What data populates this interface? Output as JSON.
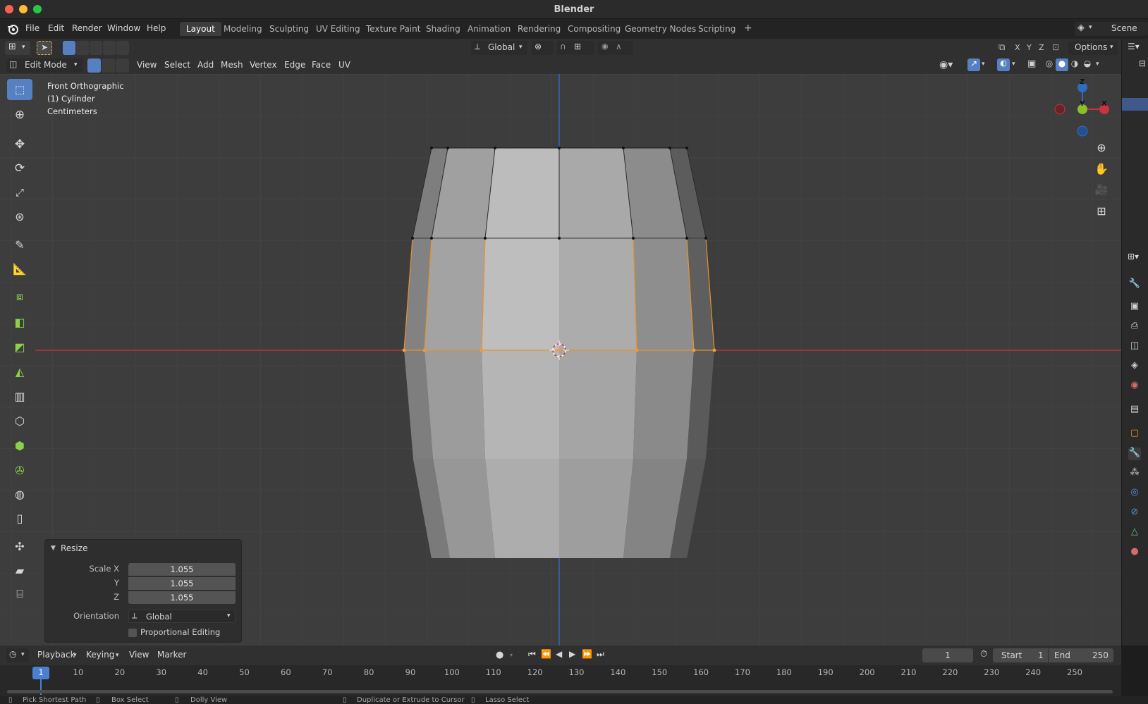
{
  "window": {
    "title": "Blender"
  },
  "menubar": {
    "items": [
      "File",
      "Edit",
      "Render",
      "Window",
      "Help"
    ],
    "tabs": [
      "Layout",
      "Modeling",
      "Sculpting",
      "UV Editing",
      "Texture Paint",
      "Shading",
      "Animation",
      "Rendering",
      "Compositing",
      "Geometry Nodes",
      "Scripting"
    ],
    "active_tab": "Layout",
    "add_tab": "+",
    "scene": "Scene"
  },
  "header1": {
    "orientation": "Global",
    "axes": [
      "X",
      "Y",
      "Z"
    ],
    "options": "Options"
  },
  "header2": {
    "mode": "Edit Mode",
    "menus": [
      "View",
      "Select",
      "Add",
      "Mesh",
      "Vertex",
      "Edge",
      "Face",
      "UV"
    ]
  },
  "viewport": {
    "view_name": "Front Orthographic",
    "object_name": "(1) Cylinder",
    "units": "Centimeters",
    "gizmo_axes": {
      "z": "Z",
      "y": "Y",
      "x": "X"
    }
  },
  "resize_panel": {
    "title": "Resize",
    "scale_x_label": "Scale X",
    "scale_y_label": "Y",
    "scale_z_label": "Z",
    "scale_x": "1.055",
    "scale_y": "1.055",
    "scale_z": "1.055",
    "orientation_label": "Orientation",
    "orientation_value": "Global",
    "proportional_label": "Proportional Editing",
    "proportional_checked": false
  },
  "timeline": {
    "menus": [
      "Playback",
      "Keying",
      "View",
      "Marker"
    ],
    "current_frame": "1",
    "start_label": "Start",
    "start": "1",
    "end_label": "End",
    "end": "250",
    "ticks": [
      "10",
      "20",
      "30",
      "40",
      "50",
      "60",
      "70",
      "80",
      "90",
      "100",
      "110",
      "120",
      "130",
      "140",
      "150",
      "160",
      "170",
      "180",
      "190",
      "200",
      "210",
      "220",
      "230",
      "240",
      "250"
    ],
    "playhead": "1"
  },
  "statusbar": {
    "items": [
      "Pick Shortest Path",
      "Box Select",
      "Dolly View",
      "Duplicate or Extrude to Cursor",
      "Lasso Select"
    ]
  },
  "colors": {
    "accent": "#5680c2",
    "selection": "#e8932a",
    "x_axis": "#c8333f",
    "z_axis": "#2e6cc4"
  }
}
